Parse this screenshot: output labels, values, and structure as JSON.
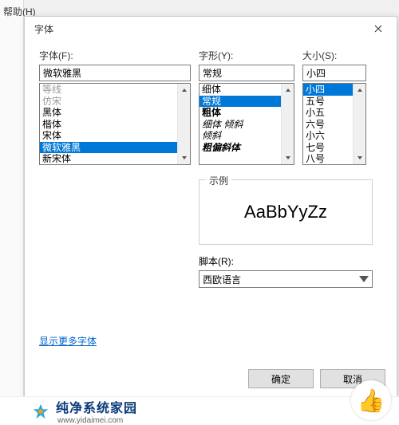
{
  "menu_remnant": "帮助(H)",
  "dialog": {
    "title": "字体",
    "font": {
      "label": "字体(F):",
      "value": "微软雅黑",
      "items": [
        "等线",
        "仿宋",
        "黑体",
        "楷体",
        "宋体",
        "微软雅黑",
        "新宋体"
      ],
      "selected_index": 5
    },
    "style": {
      "label": "字形(Y):",
      "value": "常规",
      "items": [
        {
          "t": "细体"
        },
        {
          "t": "常规",
          "sel": true
        },
        {
          "t": "粗体",
          "bold": true
        },
        {
          "t": "细体 倾斜",
          "italic": true
        },
        {
          "t": "倾斜",
          "italic": true
        },
        {
          "t": "粗偏斜体",
          "bold": true,
          "italic": true
        }
      ]
    },
    "size": {
      "label": "大小(S):",
      "value": "小四",
      "items": [
        "小四",
        "五号",
        "小五",
        "六号",
        "小六",
        "七号",
        "八号"
      ],
      "selected_index": 0
    },
    "sample": {
      "label": "示例",
      "text": "AaBbYyZz"
    },
    "script": {
      "label": "脚本(R):",
      "value": "西欧语言"
    },
    "more_fonts_link": "显示更多字体",
    "ok": "确定",
    "cancel": "取消"
  },
  "watermark": {
    "brand": "纯净系统家园",
    "url": "www.yidaimei.com"
  }
}
